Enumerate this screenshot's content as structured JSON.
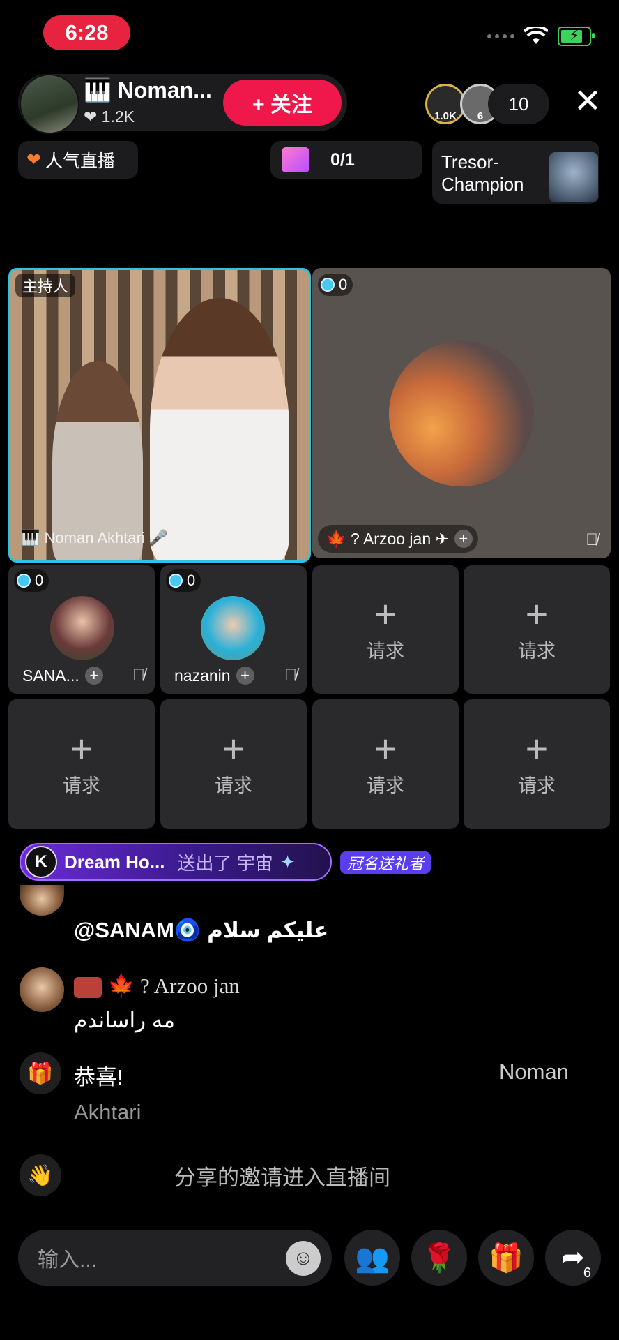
{
  "status": {
    "time": "6:28"
  },
  "host": {
    "name": "🎹 Noman...",
    "likes": "❤ 1.2K",
    "follow_label": "+ 关注"
  },
  "viewers": {
    "avatar_1_badge": "1.0K",
    "avatar_2_badge": "6",
    "count": "10"
  },
  "tags": {
    "popular": "人气直播",
    "gift_goal": "0/1",
    "tresor": "Tresor-Champion"
  },
  "host_seat": {
    "tag": "主持人",
    "caption": "🎹 Noman Akhtari 🎤"
  },
  "seats": [
    {
      "score": "0",
      "name": "🍁 ? Arzoo jan ✈"
    },
    {
      "score": "0",
      "name": "SANA..."
    },
    {
      "score": "0",
      "name": "nazanin"
    }
  ],
  "request_label": "请求",
  "gift_banner": {
    "user": "Dream Ho...",
    "action": "送出了 宇宙",
    "crown": "冠名送礼者"
  },
  "chat": {
    "line1": "@SANAM🧿 علیکم سلام",
    "line2_user": "🍁 ? Arzoo jan",
    "line2_msg": "مه راساندم",
    "line3_a": "恭喜!",
    "line3_b": "Noman",
    "line3_c": "Akhtari",
    "line4": "分享的邀请进入直播间"
  },
  "bottom": {
    "input_placeholder": "输入...",
    "share_count": "6"
  },
  "colors": {
    "accent_red": "#f0184b",
    "host_frame": "#2ac5e0",
    "battery": "#3dd35b"
  }
}
